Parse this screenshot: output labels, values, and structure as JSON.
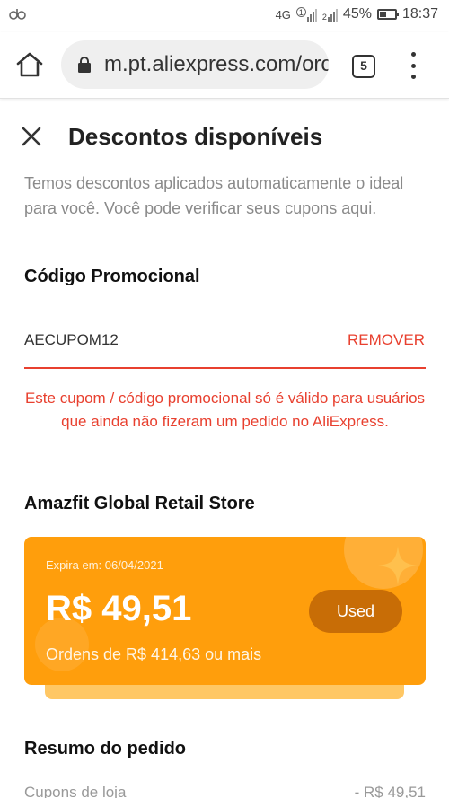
{
  "status_bar": {
    "left_icon": "notification-icon",
    "network": "4G",
    "sim1": "1",
    "sim2": "2",
    "battery_pct": "45%",
    "time": "18:37"
  },
  "browser": {
    "url": "m.pt.aliexpress.com/orc",
    "tab_count": "5"
  },
  "page": {
    "title": "Descontos disponíveis",
    "description": "Temos descontos aplicados automaticamente o ideal para você. Você pode verificar seus cupons aqui."
  },
  "promo": {
    "section_title": "Código Promocional",
    "code": "AECUPOM12",
    "remove_label": "REMOVER",
    "error": "Este cupom / código promocional só é válido para usuários que ainda não fizeram um pedido no AliExpress."
  },
  "store": {
    "name": "Amazfit Global Retail Store",
    "coupon": {
      "expiry": "Expira em: 06/04/2021",
      "amount": "R$ 49,51",
      "min_order": "Ordens de R$ 414,63 ou mais",
      "status": "Used"
    }
  },
  "summary": {
    "title": "Resumo do pedido",
    "rows": [
      {
        "label": "Cupons de loja",
        "value": "- R$ 49,51"
      }
    ]
  },
  "colors": {
    "accent_red": "#e8402f",
    "coupon_orange": "#ff9e0c",
    "used_button": "#c86d06"
  }
}
